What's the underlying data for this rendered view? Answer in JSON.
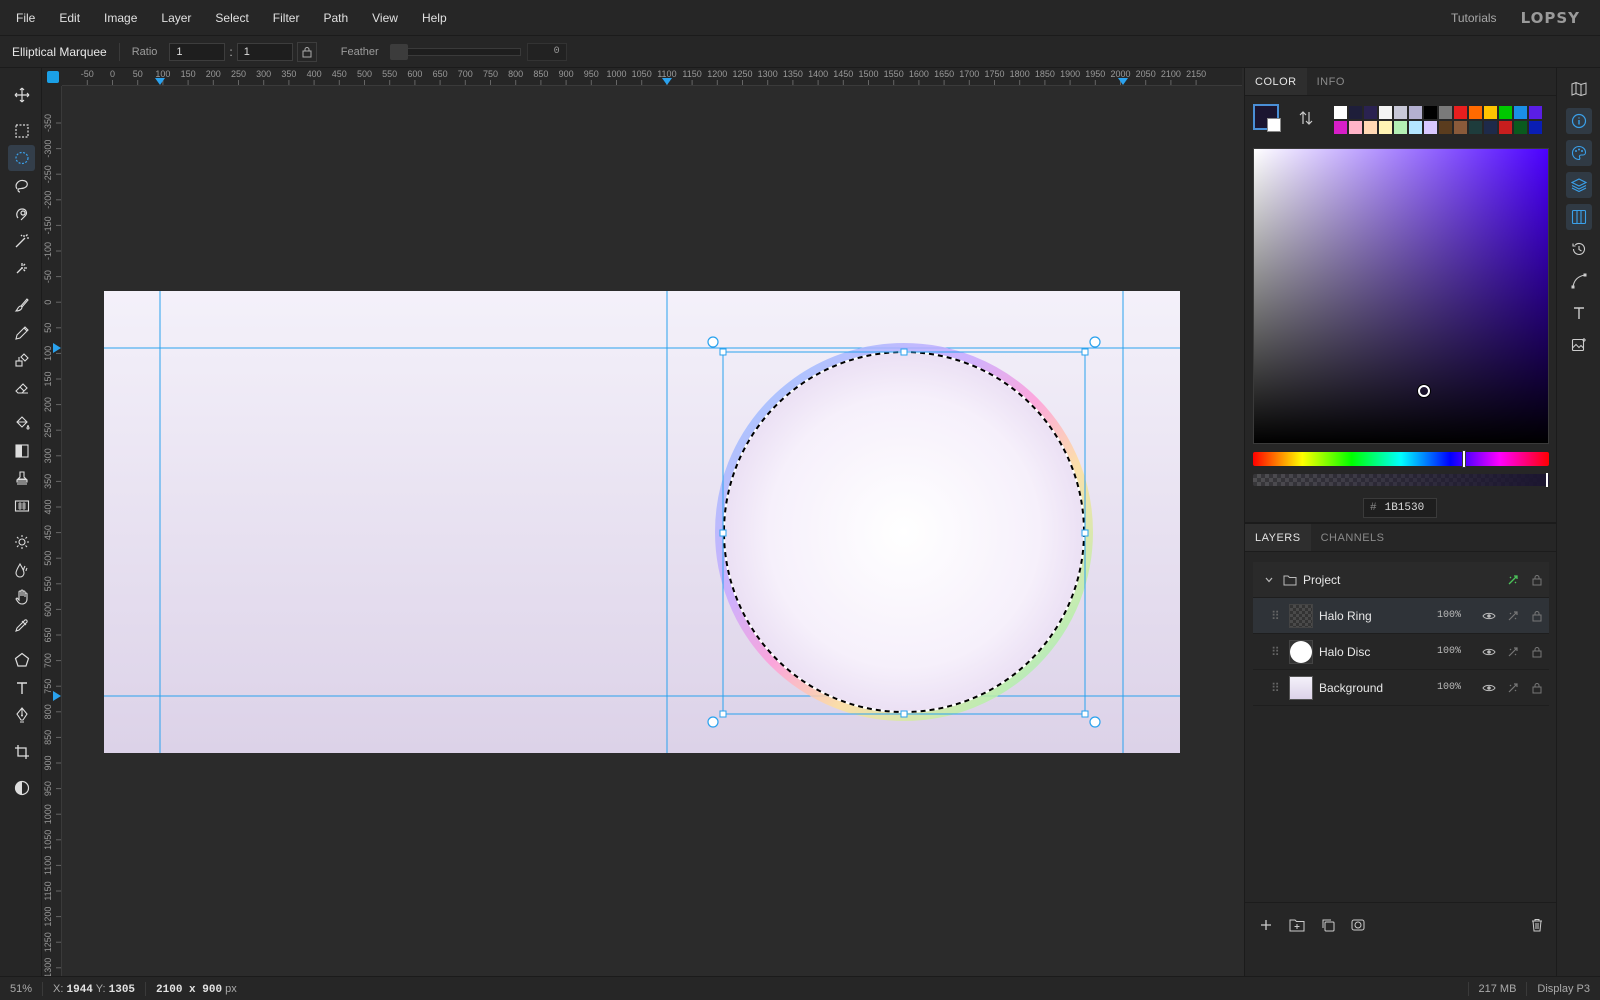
{
  "menu": [
    "File",
    "Edit",
    "Image",
    "Layer",
    "Select",
    "Filter",
    "Path",
    "View",
    "Help"
  ],
  "header": {
    "tutorials": "Tutorials",
    "logo": "LOPSY"
  },
  "options": {
    "tool_name": "Elliptical Marquee",
    "ratio_label": "Ratio",
    "ratio_w": "1",
    "ratio_sep": ":",
    "ratio_h": "1",
    "feather_label": "Feather",
    "feather_value": "0"
  },
  "tools": [
    {
      "name": "move-tool",
      "icon": "move"
    },
    {
      "name": "rect-marquee-tool",
      "icon": "rect-select"
    },
    {
      "name": "ellipse-marquee-tool",
      "icon": "ellipse-select",
      "active": true
    },
    {
      "name": "lasso-tool",
      "icon": "lasso"
    },
    {
      "name": "quick-select-tool",
      "icon": "quick-select"
    },
    {
      "name": "magic-wand-tool",
      "icon": "magic-wand"
    },
    {
      "name": "spot-heal-tool",
      "icon": "spot-heal"
    },
    {
      "name": "brush-tool",
      "icon": "brush"
    },
    {
      "name": "pencil-tool",
      "icon": "pencil"
    },
    {
      "name": "clone-tool",
      "icon": "clone"
    },
    {
      "name": "eraser-tool",
      "icon": "eraser"
    },
    {
      "name": "bucket-tool",
      "icon": "bucket"
    },
    {
      "name": "gradient-tool",
      "icon": "gradient"
    },
    {
      "name": "stamp-tool",
      "icon": "stamp"
    },
    {
      "name": "pattern-tool",
      "icon": "pattern"
    },
    {
      "name": "dodge-tool",
      "icon": "dodge"
    },
    {
      "name": "blur-tool",
      "icon": "blur"
    },
    {
      "name": "hand-tool",
      "icon": "hand"
    },
    {
      "name": "eyedropper-tool",
      "icon": "eyedropper"
    },
    {
      "name": "shape-tool",
      "icon": "polygon"
    },
    {
      "name": "text-tool",
      "icon": "text"
    },
    {
      "name": "pen-tool",
      "icon": "pen"
    },
    {
      "name": "crop-tool",
      "icon": "crop"
    },
    {
      "name": "mask-mode-tool",
      "icon": "half-circle"
    }
  ],
  "ruler_top": [
    "-50",
    "0",
    "50",
    "100",
    "150",
    "200",
    "250",
    "300",
    "350",
    "400",
    "450",
    "500",
    "550",
    "600",
    "650",
    "700",
    "750",
    "800",
    "850",
    "900",
    "950",
    "1000",
    "1050",
    "1100",
    "1150",
    "1200",
    "1250",
    "1300",
    "1350",
    "1400",
    "1450",
    "1500",
    "1550",
    "1600",
    "1650",
    "1700",
    "1750",
    "1800",
    "1850",
    "1900",
    "1950",
    "2000",
    "2050",
    "2100",
    "2150"
  ],
  "ruler_left": [
    "-350",
    "-300",
    "-250",
    "-200",
    "-150",
    "-100",
    "-50",
    "0",
    "50",
    "100",
    "150",
    "200",
    "250",
    "300",
    "350",
    "400",
    "450",
    "500",
    "550",
    "600",
    "650",
    "700",
    "750",
    "800",
    "850",
    "900",
    "950",
    "1000",
    "1050",
    "1100",
    "1150",
    "1200",
    "1250",
    "1300"
  ],
  "color_panel": {
    "tabs": [
      "COLOR",
      "INFO"
    ],
    "foreground": "#1B1530",
    "background": "#FFFFFF",
    "hex_label": "#",
    "hex_value": "1B1530",
    "swatches": [
      "#ffffff",
      "#1e1e3a",
      "#2a2250",
      "#f4f4f4",
      "#c8c8d8",
      "#b4b0d0",
      "#000000",
      "#7a7a7a",
      "#e81e1e",
      "#ff6a00",
      "#ffc400",
      "#00c800",
      "#1a8fe6",
      "#5a1ee6",
      "#d81ec8",
      "#ffb4c8",
      "#ffd8b4",
      "#fff4b4",
      "#b4f0b4",
      "#b4e6ff",
      "#d8c8ff",
      "#5a3c1e",
      "#8a5a3a",
      "#1e3c3c",
      "#1e2a4a",
      "#c81e1e",
      "#0a5a1e",
      "#0a1eb4"
    ]
  },
  "layers_panel": {
    "tabs": [
      "LAYERS",
      "CHANNELS"
    ],
    "group": {
      "name": "Project"
    },
    "layers": [
      {
        "name": "Halo Ring",
        "opacity": "100%",
        "thumb": "checker",
        "selected": true
      },
      {
        "name": "Halo Disc",
        "opacity": "100%",
        "thumb": "disc"
      },
      {
        "name": "Background",
        "opacity": "100%",
        "thumb": "bg"
      }
    ]
  },
  "status": {
    "zoom": "51%",
    "x_label": "X:",
    "x": "1944",
    "y_label": "Y:",
    "y": "1305",
    "size": "2100 x 900",
    "size_unit": "px",
    "memory": "217 MB",
    "color_profile": "Display P3"
  }
}
